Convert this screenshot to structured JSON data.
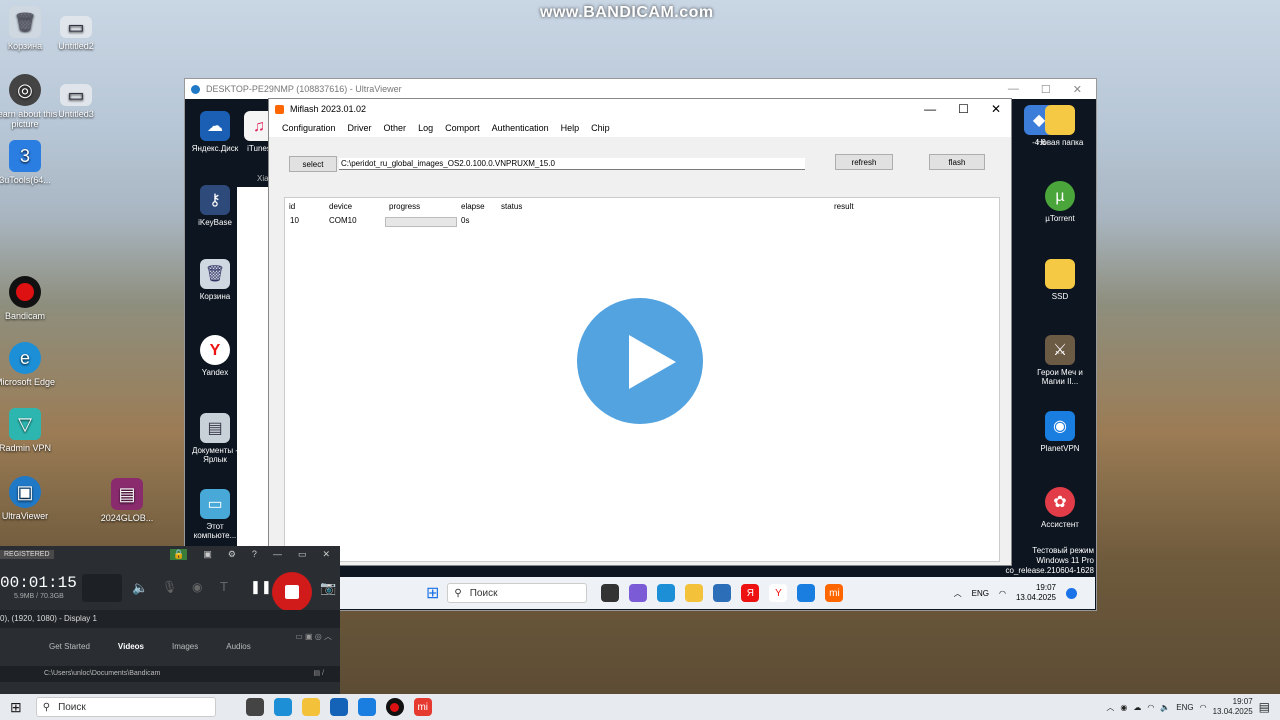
{
  "watermark": "www.BANDICAM.com",
  "host_desktop_icons": [
    {
      "label": "Корзина",
      "icon": "recycle-bin-icon"
    },
    {
      "label": "Untitled2",
      "icon": "monitor-icon"
    },
    {
      "label": "Learn about this picture",
      "icon": "camera-icon"
    },
    {
      "label": "Untitled3",
      "icon": "monitor-icon"
    },
    {
      "label": "3uTools(64...",
      "icon": "3utools-icon"
    },
    {
      "label": "Bandicam",
      "icon": "record-icon"
    },
    {
      "label": "Microsoft Edge",
      "icon": "edge-icon"
    },
    {
      "label": "Radmin VPN",
      "icon": "vpn-icon"
    },
    {
      "label": "UltraViewer",
      "icon": "remote-icon"
    },
    {
      "label": "2024GLOB...",
      "icon": "winrar-icon"
    }
  ],
  "ultraviewer": {
    "title": "DESKTOP-PE29NMP (108837616) - UltraViewer"
  },
  "remote_icons_left": [
    {
      "label": "Яндекс.Диск",
      "icon": "yandex-disk-icon"
    },
    {
      "label": "iTunes",
      "icon": "itunes-icon"
    },
    {
      "label": "iKeyBase",
      "icon": "key-icon"
    },
    {
      "label": "Корзина",
      "icon": "recycle-bin-icon"
    },
    {
      "label": "Yandex",
      "icon": "yandex-icon"
    },
    {
      "label": "Документы - Ярлык",
      "icon": "folder-icon"
    },
    {
      "label": "Этот компьюте...",
      "icon": "computer-icon"
    }
  ],
  "remote_icons_right": [
    {
      "label": "-4.6",
      "icon": "app-icon"
    },
    {
      "label": "Новая папка",
      "icon": "folder-icon"
    },
    {
      "label": "µTorrent",
      "icon": "utorrent-icon"
    },
    {
      "label": "SSD",
      "icon": "folder-icon"
    },
    {
      "label": "Герои Меч и Магии II...",
      "icon": "game-icon"
    },
    {
      "label": "PlanetVPN",
      "icon": "vpn-icon"
    },
    {
      "label": "Ассистент",
      "icon": "assistant-icon"
    }
  ],
  "remote_watermark": {
    "line1": "Тестовый режим",
    "line2": "Windows 11 Pro",
    "line3": "co_release.210604-1628"
  },
  "explorer_partial": "Xiao",
  "miflash": {
    "title": "Miflash 2023.01.02",
    "menu": [
      "Configuration",
      "Driver",
      "Other",
      "Log",
      "Comport",
      "Authentication",
      "Help",
      "Chip"
    ],
    "select_label": "select",
    "path": "C:\\peridot_ru_global_images_OS2.0.100.0.VNPRUXM_15.0",
    "refresh_label": "refresh",
    "flash_label": "flash",
    "columns": [
      "id",
      "device",
      "progress",
      "elapse",
      "status",
      "result"
    ],
    "rows": [
      {
        "id": "10",
        "device": "COM10",
        "progress": 0,
        "elapse": "0s",
        "status": "",
        "result": ""
      }
    ]
  },
  "remote_taskbar": {
    "search": "Поиск",
    "lang": "ENG",
    "time": "19:07",
    "date": "13.04.2025"
  },
  "bandicam": {
    "registered": "REGISTERED",
    "timer": "00:01:15",
    "size": "5.9MB / 70.3GB",
    "display": "0), (1920, 1080) - Display 1",
    "tabs": [
      "Get Started",
      "Videos",
      "Images",
      "Audios"
    ],
    "active_tab": "Videos",
    "path": "C:\\Users\\unloc\\Documents\\Bandicam"
  },
  "taskbar": {
    "search": "Поиск",
    "lang": "ENG",
    "time": "19:07",
    "date": "13.04.2025"
  }
}
